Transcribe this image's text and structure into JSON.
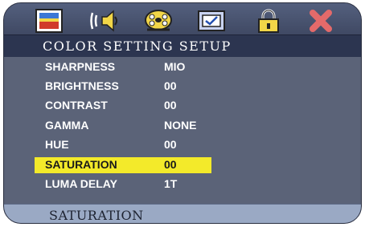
{
  "icons": [
    "picture-icon",
    "audio-speaker-icon",
    "film-reel-icon",
    "checkbox-icon",
    "lock-icon",
    "close-x-icon"
  ],
  "title": "COLOR SETTING SETUP",
  "settings": [
    {
      "label": "SHARPNESS",
      "value": "MIO"
    },
    {
      "label": "BRIGHTNESS",
      "value": "00"
    },
    {
      "label": "CONTRAST",
      "value": "00"
    },
    {
      "label": "GAMMA",
      "value": "NONE"
    },
    {
      "label": "HUE",
      "value": "00"
    },
    {
      "label": "SATURATION",
      "value": "00",
      "selected": true
    },
    {
      "label": "LUMA DELAY",
      "value": "1T"
    }
  ],
  "status": "SATURATION",
  "colors": {
    "highlight": "#f3ea2a",
    "panel": "#5b6378",
    "title_strip": "#2c3550",
    "status_bar": "#9aa9c4"
  }
}
